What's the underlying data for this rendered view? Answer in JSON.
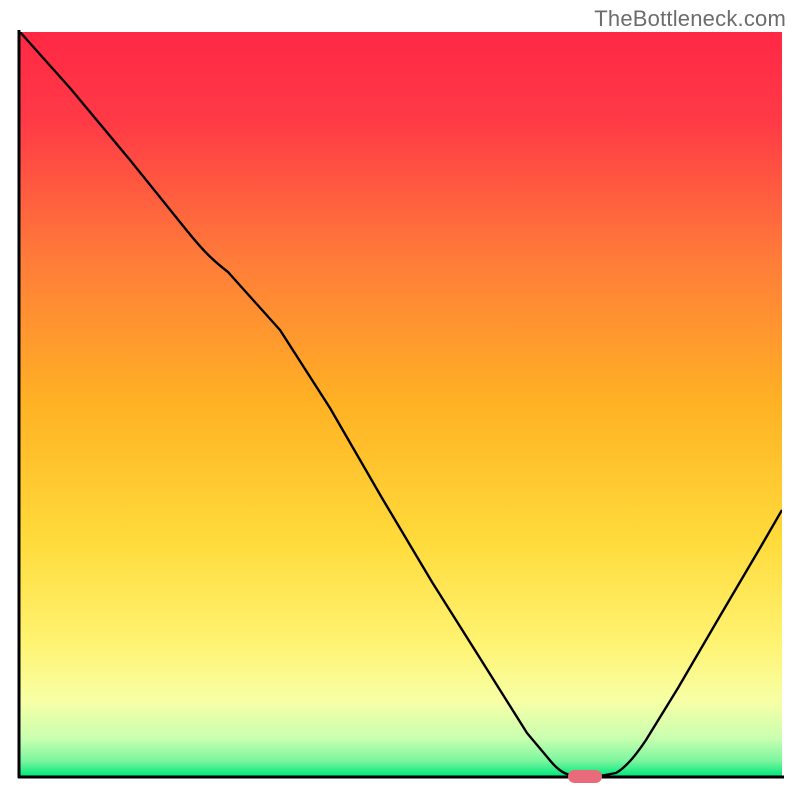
{
  "watermark": "TheBottleneck.com",
  "chart_data": {
    "type": "line",
    "title": "",
    "xlabel": "",
    "ylabel": "",
    "xlim": [
      0,
      100
    ],
    "ylim": [
      0,
      100
    ],
    "background_gradient": {
      "top": "#ff2845",
      "mid_upper": "#ffa823",
      "mid_lower": "#fff371",
      "bottom": "#00e87b"
    },
    "series": [
      {
        "name": "bottleneck-curve",
        "type": "line",
        "color": "#000000",
        "x": [
          0,
          5,
          10,
          18,
          24,
          30,
          37,
          44,
          51,
          58,
          61,
          64,
          68,
          72,
          75,
          78,
          82,
          88,
          94,
          100
        ],
        "y": [
          99,
          93,
          86,
          76,
          70,
          64,
          53,
          41,
          29,
          16,
          10,
          4,
          1,
          0,
          0,
          2,
          8,
          18,
          28,
          38
        ]
      }
    ],
    "markers": [
      {
        "name": "optimal-point",
        "x": 73,
        "y": 0,
        "color": "#e96a7a",
        "shape": "rounded-rect"
      }
    ],
    "axes_visible": true,
    "grid": false
  }
}
